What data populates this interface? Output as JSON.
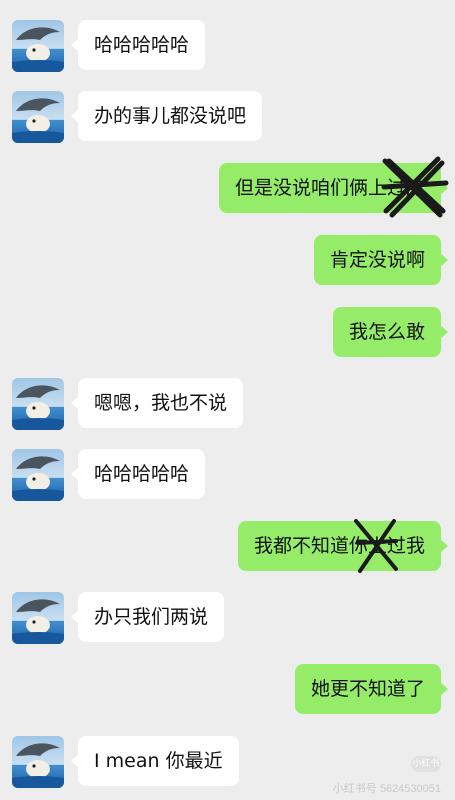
{
  "messages": [
    {
      "side": "in",
      "text": "哈哈哈哈哈"
    },
    {
      "side": "in",
      "text": "办的事儿都没说吧"
    },
    {
      "side": "out",
      "text": "但是没说咱们俩上过床"
    },
    {
      "side": "out",
      "text": "肯定没说啊"
    },
    {
      "side": "out",
      "text": "我怎么敢"
    },
    {
      "side": "in",
      "text": "嗯嗯，我也不说"
    },
    {
      "side": "in",
      "text": "哈哈哈哈哈"
    },
    {
      "side": "out",
      "text": "我都不知道你上过我"
    },
    {
      "side": "in",
      "text": "办只我们两说"
    },
    {
      "side": "out",
      "text": "她更不知道了"
    },
    {
      "side": "in",
      "text": "I mean 你最近"
    }
  ],
  "avatar_icon": "dolphin-avatar-icon",
  "watermark": {
    "badge": "小红书",
    "text": "小红书号 5624530051"
  },
  "colors": {
    "bg": "#ededed",
    "incoming": "#ffffff",
    "outgoing": "#95ec69",
    "scribble": "#1a1a1a"
  }
}
